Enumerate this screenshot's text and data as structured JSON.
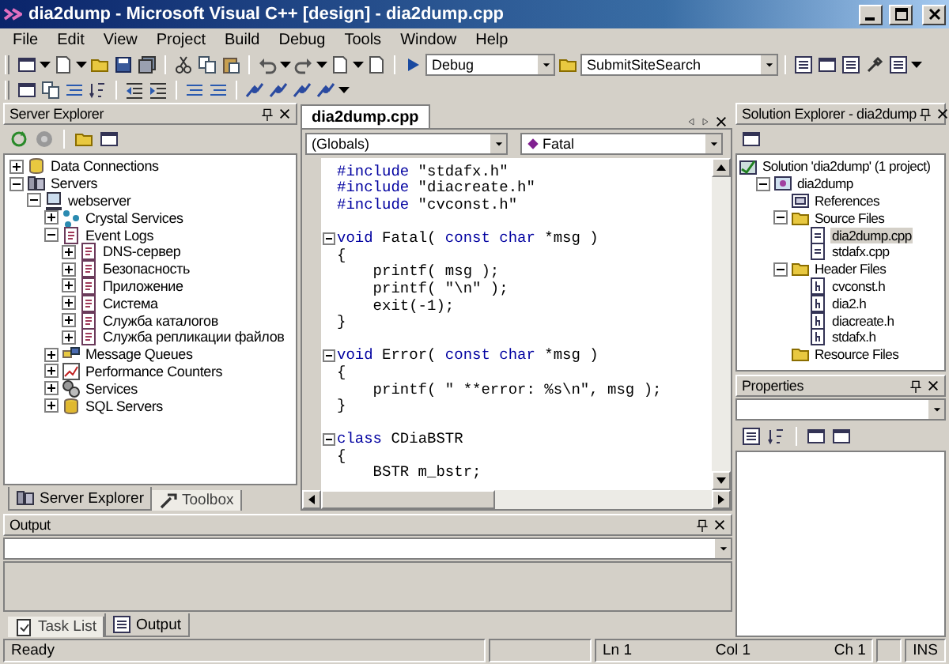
{
  "window": {
    "title": "dia2dump - Microsoft Visual C++ [design] - dia2dump.cpp"
  },
  "menu": [
    "File",
    "Edit",
    "View",
    "Project",
    "Build",
    "Debug",
    "Tools",
    "Window",
    "Help"
  ],
  "toolbar": {
    "configuration": "Debug",
    "project": "SubmitSiteSearch"
  },
  "server_explorer": {
    "title": "Server Explorer",
    "tree": [
      {
        "label": "Data Connections",
        "kind": "database",
        "expanded": false,
        "selected": false
      },
      {
        "label": "Servers",
        "kind": "servers",
        "expanded": true,
        "selected": false,
        "children": [
          {
            "label": "webserver",
            "kind": "computer",
            "expanded": true,
            "selected": false,
            "children": [
              {
                "label": "Crystal Services",
                "kind": "service",
                "expanded": false,
                "selected": false
              },
              {
                "label": "Event Logs",
                "kind": "log",
                "expanded": true,
                "selected": false,
                "children": [
                  {
                    "label": "DNS-сервер",
                    "kind": "log",
                    "expanded": false,
                    "selected": false
                  },
                  {
                    "label": "Безопасность",
                    "kind": "log",
                    "expanded": false,
                    "selected": false
                  },
                  {
                    "label": "Приложение",
                    "kind": "log",
                    "expanded": false,
                    "selected": false
                  },
                  {
                    "label": "Система",
                    "kind": "log",
                    "expanded": false,
                    "selected": false
                  },
                  {
                    "label": "Служба каталогов",
                    "kind": "log",
                    "expanded": false,
                    "selected": false
                  },
                  {
                    "label": "Служба репликации файлов",
                    "kind": "log",
                    "expanded": false,
                    "selected": false
                  }
                ]
              },
              {
                "label": "Message Queues",
                "kind": "queue",
                "expanded": false,
                "selected": false
              },
              {
                "label": "Performance Counters",
                "kind": "chart",
                "expanded": false,
                "selected": false
              },
              {
                "label": "Services",
                "kind": "gears",
                "expanded": false,
                "selected": false
              },
              {
                "label": "SQL Servers",
                "kind": "sql",
                "expanded": false,
                "selected": false
              }
            ]
          }
        ]
      }
    ],
    "tabs": [
      {
        "label": "Server Explorer",
        "kind": "servers",
        "selected": true
      },
      {
        "label": "Toolbox",
        "kind": "tools",
        "selected": false
      }
    ]
  },
  "editor": {
    "tabs": [
      {
        "label": "dia2dump.cpp",
        "selected": true
      }
    ],
    "scope": "(Globals)",
    "member": "Fatal",
    "lines": [
      {
        "kind": "code",
        "tokens": [
          {
            "kind": "keyword",
            "text": "#include"
          },
          {
            "kind": "plain",
            "text": " \"stdafx.h\""
          }
        ]
      },
      {
        "kind": "code",
        "tokens": [
          {
            "kind": "keyword",
            "text": "#include"
          },
          {
            "kind": "plain",
            "text": " \"diacreate.h\""
          }
        ]
      },
      {
        "kind": "code",
        "tokens": [
          {
            "kind": "keyword",
            "text": "#include"
          },
          {
            "kind": "plain",
            "text": " \"cvconst.h\""
          }
        ]
      },
      {
        "kind": "blank"
      },
      {
        "kind": "code",
        "fold": true,
        "tokens": [
          {
            "kind": "keyword",
            "text": "void"
          },
          {
            "kind": "plain",
            "text": " Fatal( "
          },
          {
            "kind": "keyword",
            "text": "const char"
          },
          {
            "kind": "plain",
            "text": " *msg )"
          }
        ]
      },
      {
        "kind": "code",
        "tokens": [
          {
            "kind": "plain",
            "text": "{"
          }
        ]
      },
      {
        "kind": "code",
        "tokens": [
          {
            "kind": "plain",
            "text": "    printf( msg );"
          }
        ]
      },
      {
        "kind": "code",
        "tokens": [
          {
            "kind": "plain",
            "text": "    printf( \"\\n\" );"
          }
        ]
      },
      {
        "kind": "code",
        "tokens": [
          {
            "kind": "plain",
            "text": "    exit(-1);"
          }
        ]
      },
      {
        "kind": "code",
        "tokens": [
          {
            "kind": "plain",
            "text": "}"
          }
        ]
      },
      {
        "kind": "blank"
      },
      {
        "kind": "code",
        "fold": true,
        "tokens": [
          {
            "kind": "keyword",
            "text": "void"
          },
          {
            "kind": "plain",
            "text": " Error( "
          },
          {
            "kind": "keyword",
            "text": "const char"
          },
          {
            "kind": "plain",
            "text": " *msg )"
          }
        ]
      },
      {
        "kind": "code",
        "tokens": [
          {
            "kind": "plain",
            "text": "{"
          }
        ]
      },
      {
        "kind": "code",
        "tokens": [
          {
            "kind": "plain",
            "text": "    printf( \" **error: %s\\n\", msg );"
          }
        ]
      },
      {
        "kind": "code",
        "tokens": [
          {
            "kind": "plain",
            "text": "}"
          }
        ]
      },
      {
        "kind": "blank"
      },
      {
        "kind": "code",
        "fold": true,
        "tokens": [
          {
            "kind": "keyword",
            "text": "class"
          },
          {
            "kind": "plain",
            "text": " CDiaBSTR"
          }
        ]
      },
      {
        "kind": "code",
        "tokens": [
          {
            "kind": "plain",
            "text": "{"
          }
        ]
      },
      {
        "kind": "code",
        "tokens": [
          {
            "kind": "plain",
            "text": "    BSTR m_bstr;"
          }
        ]
      }
    ]
  },
  "solution_explorer": {
    "title": "Solution Explorer - dia2dump",
    "tree": [
      {
        "label": "Solution 'dia2dump' (1 project)",
        "kind": "solution",
        "selected": false,
        "children": [
          {
            "label": "dia2dump",
            "kind": "project",
            "expanded": true,
            "selected": false,
            "children": [
              {
                "label": "References",
                "kind": "references",
                "selected": false
              },
              {
                "label": "Source Files",
                "kind": "folder",
                "expanded": true,
                "selected": false,
                "children": [
                  {
                    "label": "dia2dump.cpp",
                    "kind": "cpp",
                    "selected": true
                  },
                  {
                    "label": "stdafx.cpp",
                    "kind": "cpp",
                    "selected": false
                  }
                ]
              },
              {
                "label": "Header Files",
                "kind": "folder",
                "expanded": true,
                "selected": false,
                "children": [
                  {
                    "label": "cvconst.h",
                    "kind": "header",
                    "selected": false
                  },
                  {
                    "label": "dia2.h",
                    "kind": "header",
                    "selected": false
                  },
                  {
                    "label": "diacreate.h",
                    "kind": "header",
                    "selected": false
                  },
                  {
                    "label": "stdafx.h",
                    "kind": "header",
                    "selected": false
                  }
                ]
              },
              {
                "label": "Resource Files",
                "kind": "folder",
                "selected": false
              }
            ]
          }
        ]
      }
    ]
  },
  "properties": {
    "title": "Properties"
  },
  "output": {
    "title": "Output",
    "tabs": [
      {
        "label": "Task List",
        "kind": "task",
        "selected": false
      },
      {
        "label": "Output",
        "kind": "output",
        "selected": true
      }
    ]
  },
  "status_bar": {
    "message": "Ready",
    "line": "Ln 1",
    "column": "Col 1",
    "char": "Ch 1",
    "mode": "INS"
  }
}
